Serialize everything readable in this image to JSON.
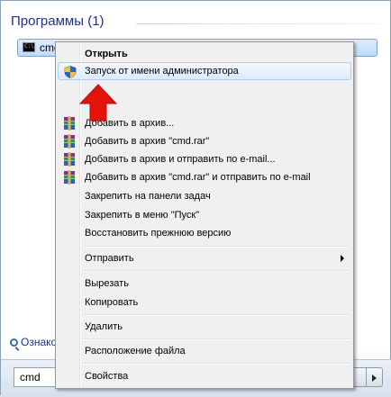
{
  "start_menu": {
    "section_header": "Программы (1)",
    "result_item": {
      "icon": "cmd-icon",
      "label": "cmd"
    },
    "see_more": "Ознако",
    "search": {
      "value": "cmd"
    }
  },
  "context_menu": {
    "open": "Открыть",
    "run_as_admin": "Запуск от имени администратора",
    "add_to_archive": "Добавить в архив...",
    "add_to_cmd_rar": "Добавить в архив \"cmd.rar\"",
    "add_and_email": "Добавить в архив и отправить по e-mail...",
    "add_cmd_rar_and_email": "Добавить в архив \"cmd.rar\" и отправить по e-mail",
    "pin_taskbar": "Закрепить на панели задач",
    "pin_start": "Закрепить в меню \"Пуск\"",
    "restore_previous": "Восстановить прежнюю версию",
    "send_to": "Отправить",
    "cut": "Вырезать",
    "copy": "Копировать",
    "delete": "Удалить",
    "file_location": "Расположение файла",
    "properties": "Свойства"
  },
  "colors": {
    "header_text": "#1e3287",
    "hover_border": "#aecff7",
    "arrow_red": "#e3120b"
  }
}
